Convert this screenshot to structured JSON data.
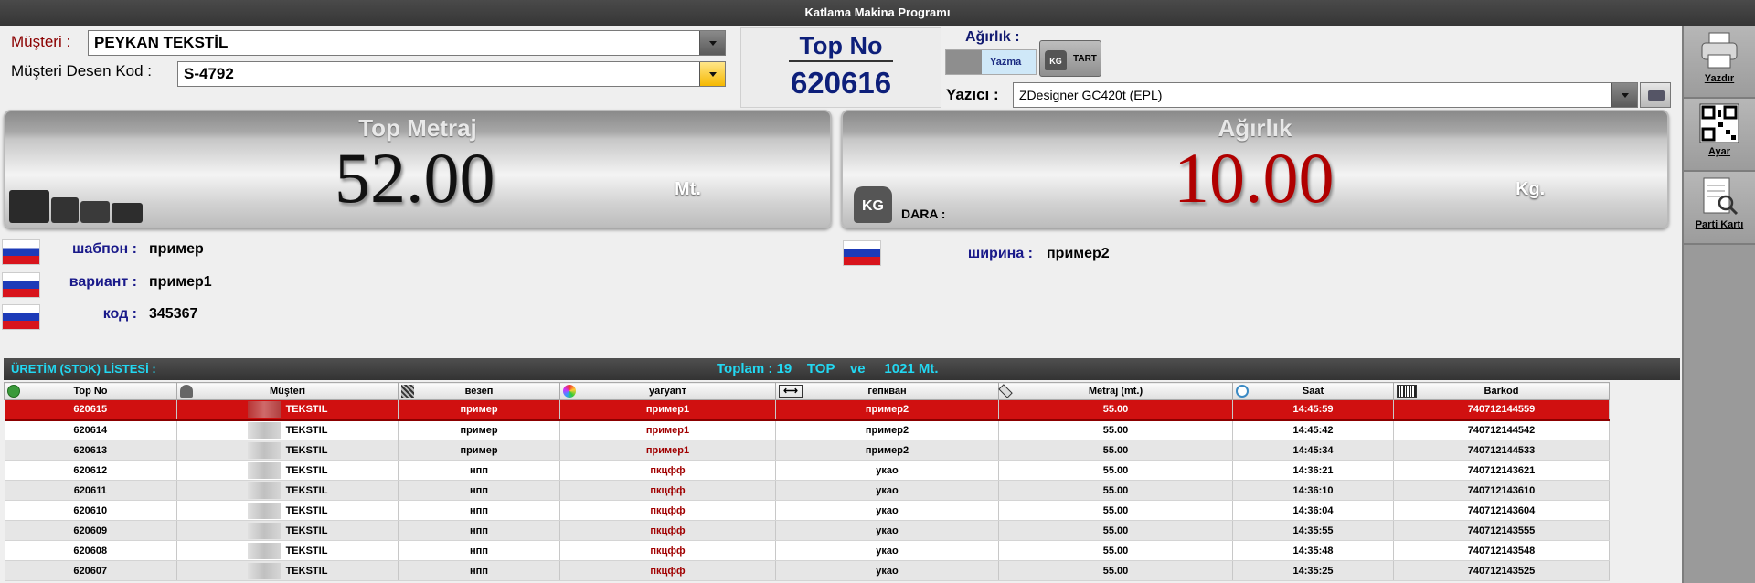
{
  "window": {
    "title": "Katlama Makina Programı"
  },
  "form": {
    "musteri_label": "Müşteri :",
    "musteri_value": "PEYKAN TEKSTİL",
    "desen_label": "Müşteri Desen Kod :",
    "desen_value": "S-4792"
  },
  "top_no": {
    "label": "Top No",
    "value": "620616"
  },
  "agirlik_ctrl": {
    "label": "Ağırlık :",
    "yazma_label": "Yazma",
    "tart_label": "TART",
    "kg_icon_text": "KG"
  },
  "yazici": {
    "label": "Yazıcı :",
    "value": "ZDesigner GC420t (EPL)"
  },
  "metraj": {
    "title": "Top Metraj",
    "value": "52.00",
    "unit": "Mt.",
    "color": "#111111"
  },
  "agirlik": {
    "title": "Ağırlık",
    "value": "10.00",
    "unit": "Kg.",
    "dara_label": "DARA :",
    "kg_icon_text": "KG",
    "color": "#b00000"
  },
  "fields": [
    {
      "label": "шабпон :",
      "value": "пример"
    },
    {
      "label": "вариант :",
      "value": "пример1"
    },
    {
      "label": "код :",
      "value": "345367"
    }
  ],
  "field_right": {
    "label": "ширина :",
    "value": "пример2"
  },
  "list": {
    "title": "ÜRETİM (STOK) LİSTESİ :",
    "summary": "Toplam : 19    TOP    ve     1021 Mt."
  },
  "table": {
    "columns": [
      "Top No",
      "Müşteri",
      "везеп",
      "yaгуаnт",
      "гепкван",
      "Metraj (mt.)",
      "Saat",
      "Barkod"
    ],
    "rows": [
      {
        "top_no": "620615",
        "musteri": "TEKSTIL",
        "c3": "пример",
        "c4": "пример1",
        "c5": "пример2",
        "metraj": "55.00",
        "saat": "14:45:59",
        "barkod": "740712144559"
      },
      {
        "top_no": "620614",
        "musteri": "TEKSTIL",
        "c3": "пример",
        "c4": "пример1",
        "c5": "пример2",
        "metraj": "55.00",
        "saat": "14:45:42",
        "barkod": "740712144542"
      },
      {
        "top_no": "620613",
        "musteri": "TEKSTIL",
        "c3": "пример",
        "c4": "пример1",
        "c5": "пример2",
        "metraj": "55.00",
        "saat": "14:45:34",
        "barkod": "740712144533"
      },
      {
        "top_no": "620612",
        "musteri": "TEKSTIL",
        "c3": "нпп",
        "c4": "пкцфф",
        "c5": "укао",
        "metraj": "55.00",
        "saat": "14:36:21",
        "barkod": "740712143621"
      },
      {
        "top_no": "620611",
        "musteri": "TEKSTIL",
        "c3": "нпп",
        "c4": "пкцфф",
        "c5": "укао",
        "metraj": "55.00",
        "saat": "14:36:10",
        "barkod": "740712143610"
      },
      {
        "top_no": "620610",
        "musteri": "TEKSTIL",
        "c3": "нпп",
        "c4": "пкцфф",
        "c5": "укао",
        "metraj": "55.00",
        "saat": "14:36:04",
        "barkod": "740712143604"
      },
      {
        "top_no": "620609",
        "musteri": "TEKSTIL",
        "c3": "нпп",
        "c4": "пкцфф",
        "c5": "укао",
        "metraj": "55.00",
        "saat": "14:35:55",
        "barkod": "740712143555"
      },
      {
        "top_no": "620608",
        "musteri": "TEKSTIL",
        "c3": "нпп",
        "c4": "пкцфф",
        "c5": "укао",
        "metraj": "55.00",
        "saat": "14:35:48",
        "barkod": "740712143548"
      },
      {
        "top_no": "620607",
        "musteri": "TEKSTIL",
        "c3": "нпп",
        "c4": "пкцфф",
        "c5": "укао",
        "metraj": "55.00",
        "saat": "14:35:25",
        "barkod": "740712143525"
      }
    ]
  },
  "right_panel": {
    "print_label": "Yazdır",
    "settings_label": "Ayar",
    "parti_label": "Parti Kartı"
  },
  "colors": {
    "selected_row": "#d01010",
    "list_header_text": "#22d8f2",
    "top_no_text": "#0d1f7a"
  }
}
